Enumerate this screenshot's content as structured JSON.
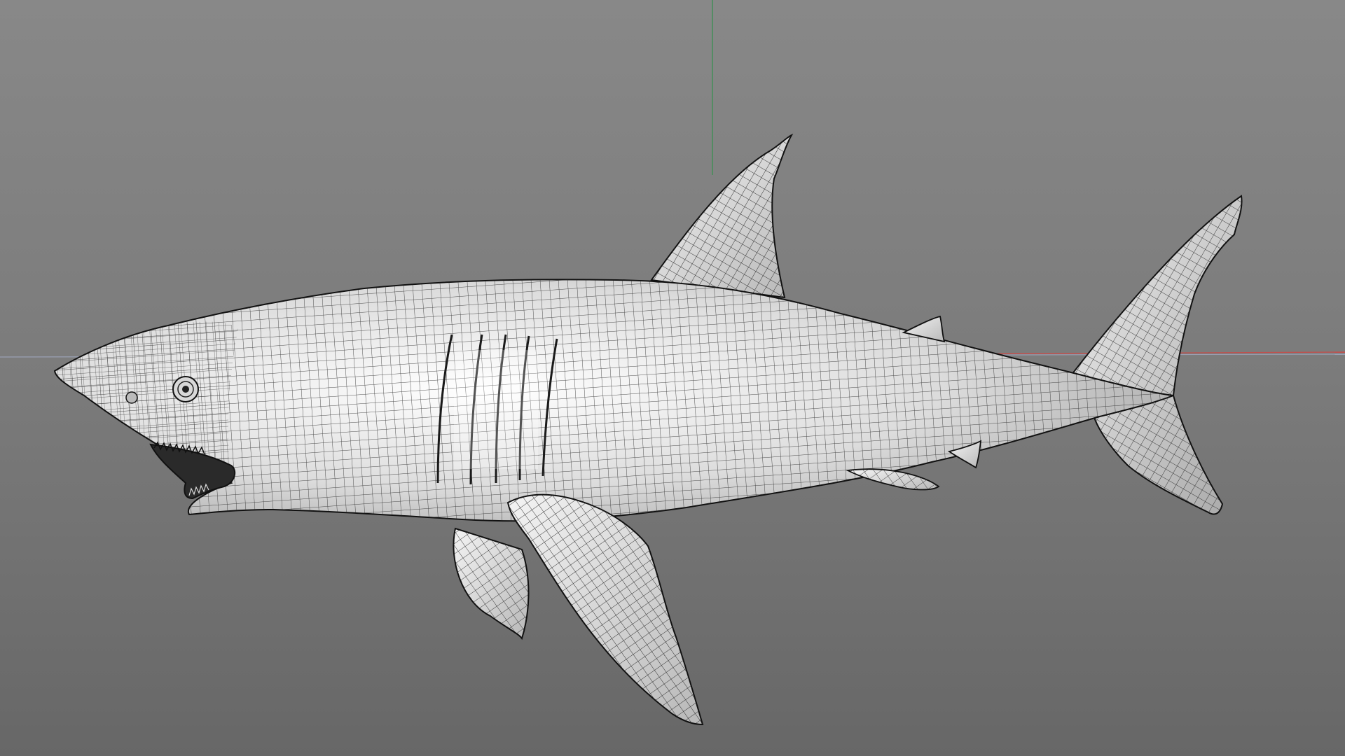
{
  "viewport": {
    "background_top": "#888888",
    "background_bottom": "#676767",
    "axis_x_color": "#c0504d",
    "axis_y_color": "#3f8f55",
    "horizon_color": "#9aa0b4"
  },
  "model": {
    "subject": "shark",
    "display_mode": "wireframe-shaded",
    "surface_color": "#ededed",
    "wire_color": "#1a1a1a"
  }
}
